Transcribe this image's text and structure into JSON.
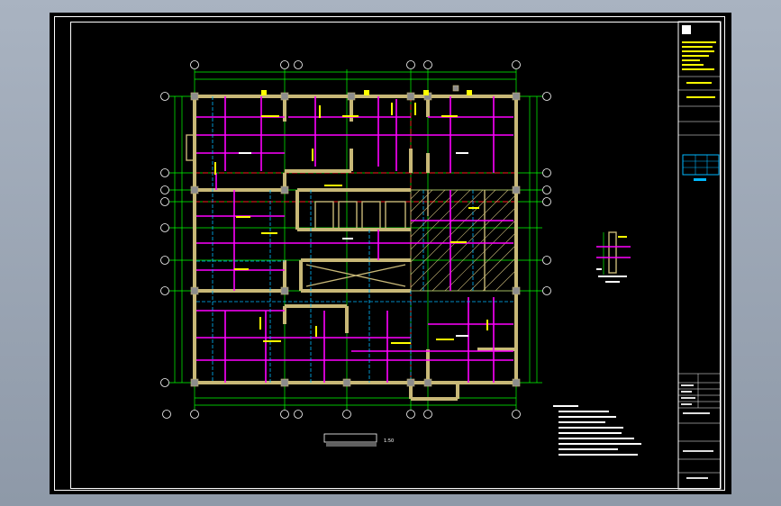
{
  "drawing": {
    "axis_marks_top": [
      "①",
      "②",
      "③",
      "④",
      "⑤",
      "⑥"
    ],
    "axis_marks_bottom": [
      "①",
      "②",
      "③",
      "④",
      "⑤",
      "⑥"
    ],
    "axis_marks_left": [
      "Ⓐ",
      "Ⓑ",
      "Ⓒ",
      "Ⓓ",
      "Ⓔ",
      "Ⓕ",
      "Ⓖ",
      "Ⓗ"
    ],
    "axis_marks_right": [
      "Ⓐ",
      "Ⓑ",
      "Ⓒ",
      "Ⓓ",
      "Ⓔ",
      "Ⓕ"
    ],
    "title_scale": "1:50"
  },
  "colors": {
    "background": "#000000",
    "wall": "#c8b877",
    "beam": "#ff00ff",
    "axis": "#00ff00",
    "red_dash": "#ff2020",
    "annotation": "#ffff00",
    "cyan": "#00b8ff",
    "white": "#ffffff"
  },
  "icons": {
    "column": "grey-square",
    "axis_bubble": "circle-marker"
  }
}
